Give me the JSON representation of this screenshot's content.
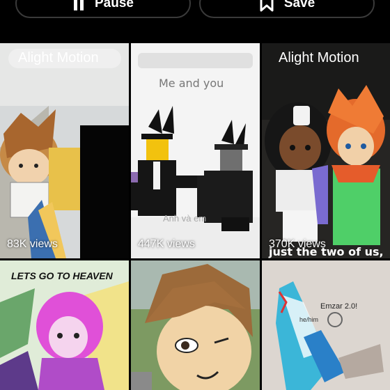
{
  "toolbar": {
    "pause_label": "Pause",
    "save_label": "Save",
    "pause_icon": "pause-icon",
    "save_icon": "bookmark-icon"
  },
  "videos": [
    {
      "watermark": "Alight Motion",
      "views": "83K views"
    },
    {
      "caption_top": "Me and you",
      "caption_bottom": "Anh và em",
      "views": "447K views"
    },
    {
      "watermark": "Alight Motion",
      "caption_bottom": "just the two of us,",
      "views": "370K views"
    },
    {
      "caption_top": "LETS GO TO HEAVEN"
    },
    {},
    {
      "name_tag": "Emzar 2.0!",
      "pronouns": "he/him"
    }
  ],
  "colors": {
    "background": "#000000",
    "pill_border": "#3a3a3a",
    "text": "#ffffff"
  }
}
